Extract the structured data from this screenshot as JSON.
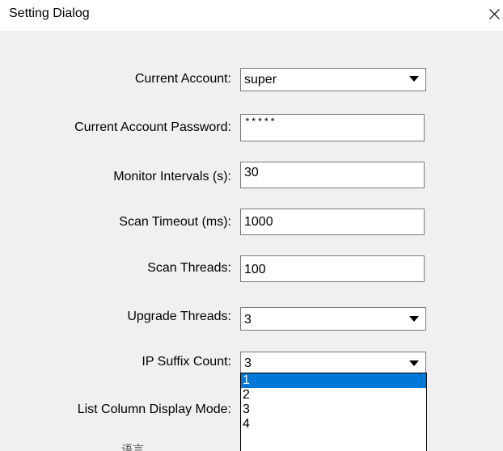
{
  "dialog": {
    "title": "Setting Dialog"
  },
  "fields": {
    "current_account": {
      "label": "Current Account:",
      "value": "super"
    },
    "current_account_password": {
      "label": "Current Account Password:",
      "value": "*****"
    },
    "monitor_intervals": {
      "label": "Monitor Intervals (s):",
      "value": "30"
    },
    "scan_timeout": {
      "label": "Scan Timeout (ms):",
      "value": "1000"
    },
    "scan_threads": {
      "label": "Scan Threads:",
      "value": "100"
    },
    "upgrade_threads": {
      "label": "Upgrade Threads:",
      "value": "3"
    },
    "ip_suffix_count": {
      "label": "IP Suffix Count:",
      "value": "3",
      "options": [
        "1",
        "2",
        "3",
        "4"
      ],
      "highlighted": "1"
    },
    "list_column_display_mode": {
      "label": "List Column Display Mode:"
    },
    "partially_hidden_label": "语言"
  },
  "icons": {
    "close": "close-icon",
    "dropdown": "chevron-down-icon"
  },
  "colors": {
    "dialog_bg": "#f0f0f0",
    "titlebar_bg": "#ffffff",
    "selection": "#0078d7"
  }
}
